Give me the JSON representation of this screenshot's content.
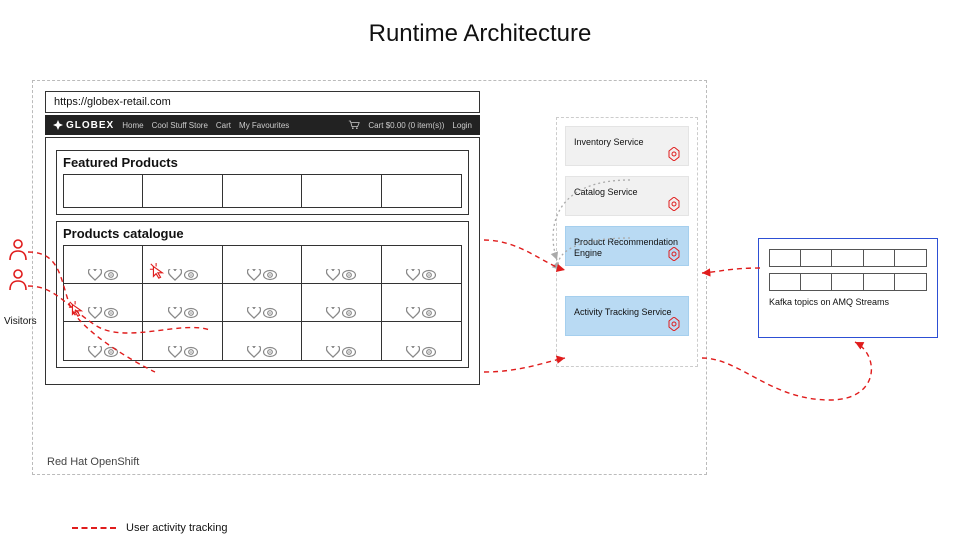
{
  "title": "Runtime Architecture",
  "browser": {
    "url": "https://globex-retail.com",
    "brand": "GLOBEX",
    "nav": {
      "home": "Home",
      "cool": "Cool Stuff Store",
      "cart_link": "Cart",
      "fav": "My Favourites",
      "cart_summary": "Cart $0.00 (0 item(s))",
      "login": "Login"
    },
    "featured_title": "Featured Products",
    "catalogue_title": "Products catalogue"
  },
  "services": {
    "inventory": "Inventory Service",
    "catalog": "Catalog Service",
    "rec": "Product Recommendation Engine",
    "activity": "Activity Tracking Service"
  },
  "kafka_label": "Kafka topics on AMQ Streams",
  "openshift_label": "Red Hat OpenShift",
  "visitors_label": "Visitors",
  "legend_label": "User activity tracking",
  "icon_names": {
    "cart": "cart-icon",
    "heart": "heart-icon",
    "eye": "eye-icon",
    "user": "user-icon",
    "click": "click-arrow-icon",
    "pod": "openshift-pod-icon"
  },
  "colors": {
    "accent_red": "#e01c1c",
    "highlight_blue": "#b9daf3",
    "kafka_border": "#2d4fd4"
  }
}
